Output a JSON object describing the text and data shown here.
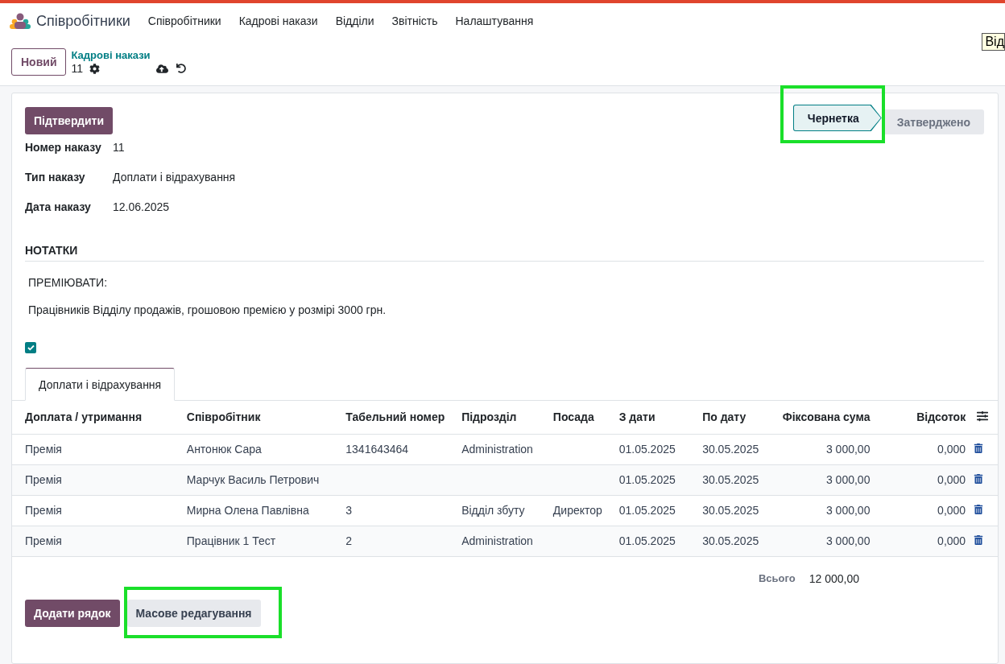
{
  "app": {
    "name": "Співробітники",
    "menu": [
      "Співробітники",
      "Кадрові накази",
      "Відділи",
      "Звітність",
      "Налаштування"
    ]
  },
  "tooltip": "Від",
  "control_panel": {
    "new_button": "Новий",
    "breadcrumb": "Кадрові накази",
    "record": "11"
  },
  "header": {
    "confirm_button": "Підтвердити",
    "stages": [
      {
        "label": "Чернетка",
        "selected": true,
        "highlighted": true
      },
      {
        "label": "Затверджено",
        "selected": false,
        "highlighted": false
      }
    ]
  },
  "fields": [
    {
      "label": "Номер наказу",
      "value": "11"
    },
    {
      "label": "Тип наказу",
      "value": "Доплати і відрахування"
    },
    {
      "label": "Дата наказу",
      "value": "12.06.2025"
    }
  ],
  "notes": {
    "title": "НОТАТКИ",
    "paragraphs": [
      "ПРЕМІЮВАТИ:",
      "Працівників Відділу продажів, грошовою премією у розмірі 3000 грн."
    ]
  },
  "checkbox": {
    "checked": true
  },
  "tabs": [
    {
      "label": "Доплати і відрахування",
      "selected": true
    }
  ],
  "table": {
    "columns": [
      {
        "label": "Доплата / утримання",
        "kind": "text"
      },
      {
        "label": "Співробітник",
        "kind": "text"
      },
      {
        "label": "Табельний номер",
        "kind": "text"
      },
      {
        "label": "Підрозділ",
        "kind": "text"
      },
      {
        "label": "Посада",
        "kind": "text"
      },
      {
        "label": "З дати",
        "kind": "text"
      },
      {
        "label": "По дату",
        "kind": "text"
      },
      {
        "label": "Фіксована сума",
        "kind": "number"
      },
      {
        "label": "Відсоток",
        "kind": "number"
      }
    ],
    "rows": [
      {
        "cells": [
          "Премія",
          "Антонюк Сара",
          "1341643464",
          "Administration",
          null,
          "01.05.2025",
          "30.05.2025",
          "3 000,00",
          "0,000"
        ]
      },
      {
        "cells": [
          "Премія",
          "Марчук Василь Петрович",
          null,
          null,
          null,
          "01.05.2025",
          "30.05.2025",
          "3 000,00",
          "0,000"
        ]
      },
      {
        "cells": [
          "Премія",
          "Мирна Олена Павлівна",
          "3",
          "Відділ збуту",
          "Директор",
          "01.05.2025",
          "30.05.2025",
          "3 000,00",
          "0,000"
        ]
      },
      {
        "cells": [
          "Премія",
          "Працівник 1 Тест",
          "2",
          "Administration",
          null,
          "01.05.2025",
          "30.05.2025",
          "3 000,00",
          "0,000"
        ]
      }
    ]
  },
  "totals": {
    "label": "Всього",
    "value": "12 000,00"
  },
  "buttons": [
    {
      "label": "Додати рядок",
      "kind": "primary",
      "highlighted": false
    },
    {
      "label": "Масове редагування",
      "kind": "secondary",
      "highlighted": true
    }
  ]
}
